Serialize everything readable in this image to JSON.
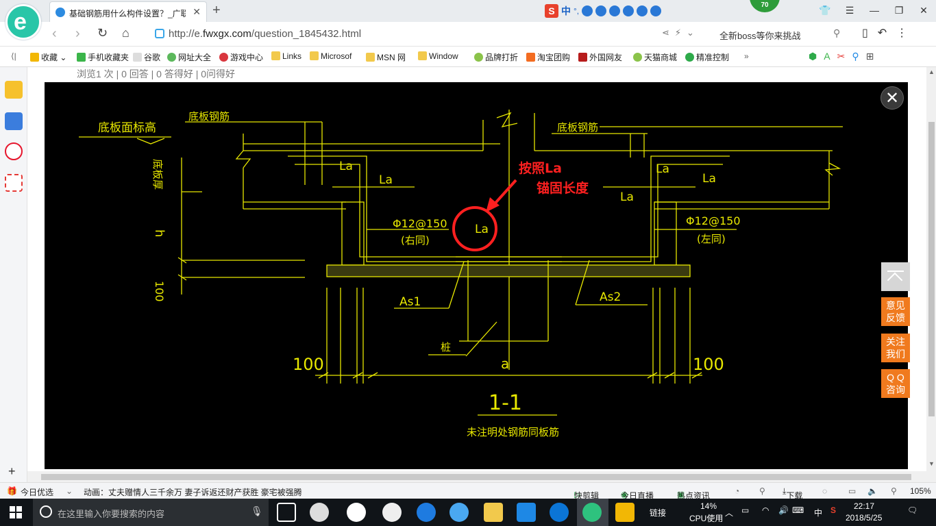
{
  "browser": {
    "tab": {
      "title": "基础钢筋用什么构件设置？_广联",
      "close": "✕"
    },
    "new_tab": "+",
    "sogou_badge": "70",
    "sogou_lang": "中",
    "url_prefix": "http://e.",
    "url_domain": "fwxgx.com",
    "url_path": "/question_1845432.html",
    "search_hint": "全新boss等你来挑战",
    "bookmarks": [
      "收藏",
      "手机收藏夹",
      "谷歌",
      "网址大全",
      "游戏中心",
      "Links",
      "Microsof",
      "MSN 网",
      "Window",
      "品牌打折",
      "淘宝团购",
      "外国网友",
      "天猫商城",
      "精准控制"
    ],
    "bookmark_more": "»"
  },
  "page": {
    "stats_text": "浏览1 次 | 0 回答 | 0 答得好 | 0问得好",
    "close_symbol": "✕",
    "float_buttons": [
      {
        "line1": "意见",
        "line2": "反馈"
      },
      {
        "line1": "关注",
        "line2": "我们"
      },
      {
        "line1": "Q Q",
        "line2": "咨询"
      }
    ]
  },
  "drawing": {
    "labels": {
      "floor_elev": "底板面标高",
      "floor_rebar_left": "底板钢筋",
      "floor_rebar_right": "底板钢筋",
      "floor_thickness": "底板厚",
      "h": "h",
      "hundred_vertical": "100",
      "la": "La",
      "rebar_spec_left": "Φ12@150",
      "rebar_note_left": "(右同)",
      "rebar_spec_right": "Φ12@150",
      "rebar_note_right": "(左同)",
      "as1": "As1",
      "as2": "As2",
      "pile": "桩",
      "a": "a",
      "dim_left": "100",
      "dim_right": "100",
      "section": "1-1",
      "note": "未注明处钢筋同板筋"
    },
    "annotation": {
      "line1": "按照La",
      "line2": "锚固长度",
      "color": "#ff2020"
    },
    "line_color": "#e8e800"
  },
  "statusbar": {
    "today": "今日优选",
    "news": "动画：丈夫赠情人三千余万 妻子诉返还财产获胜 豪宅被强腾",
    "kuaijian": "快剪辑",
    "live": "今日直播",
    "hot": "热点资讯",
    "download": "下载",
    "zoom": "105%"
  },
  "taskbar": {
    "search_placeholder": "在这里输入你要搜索的内容",
    "links": "链接",
    "cpu_percent": "14%",
    "cpu_label": "CPU使用",
    "ime": "中",
    "time": "22:17",
    "date": "2018/5/25"
  }
}
